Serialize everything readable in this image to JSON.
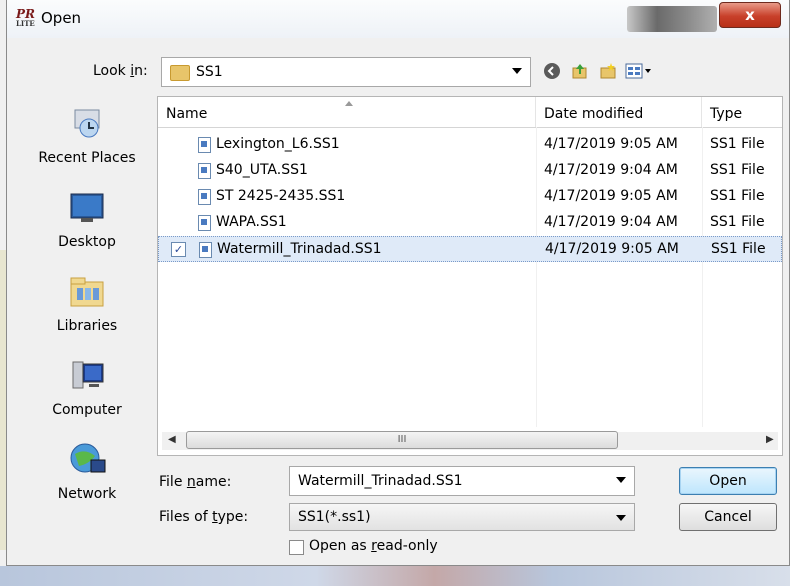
{
  "window": {
    "title": "Open",
    "app_icon_text": "PR",
    "app_icon_sub": "LITE",
    "close_label": "x"
  },
  "lookin": {
    "label": "Look in:",
    "value": "SS1"
  },
  "places": [
    {
      "label": "Recent Places",
      "icon": "recent-places-icon"
    },
    {
      "label": "Desktop",
      "icon": "desktop-icon"
    },
    {
      "label": "Libraries",
      "icon": "libraries-icon"
    },
    {
      "label": "Computer",
      "icon": "computer-icon"
    },
    {
      "label": "Network",
      "icon": "network-icon"
    }
  ],
  "columns": [
    "Name",
    "Date modified",
    "Type"
  ],
  "files": [
    {
      "name": "Lexington_L6.SS1",
      "date": "4/17/2019 9:05 AM",
      "type": "SS1 File",
      "selected": false
    },
    {
      "name": "S40_UTA.SS1",
      "date": "4/17/2019 9:04 AM",
      "type": "SS1 File",
      "selected": false
    },
    {
      "name": "ST 2425-2435.SS1",
      "date": "4/17/2019 9:05 AM",
      "type": "SS1 File",
      "selected": false
    },
    {
      "name": "WAPA.SS1",
      "date": "4/17/2019 9:04 AM",
      "type": "SS1 File",
      "selected": false
    },
    {
      "name": "Watermill_Trinadad.SS1",
      "date": "4/17/2019 9:05 AM",
      "type": "SS1 File",
      "selected": true
    }
  ],
  "scroll": {
    "grip": "III"
  },
  "filename": {
    "label": "File name:",
    "value": "Watermill_Trinadad.SS1"
  },
  "filetype": {
    "label": "Files of type:",
    "value": "SS1(*.ss1)"
  },
  "readonly": {
    "label": "Open as read-only",
    "checked": false
  },
  "buttons": {
    "open": "Open",
    "cancel": "Cancel"
  }
}
